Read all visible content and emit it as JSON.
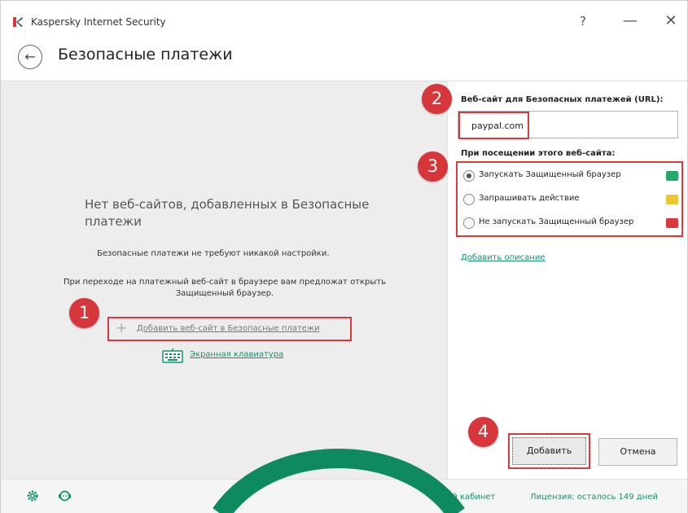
{
  "app": {
    "title": "Kaspersky Internet Security",
    "help": "?",
    "minimize": "—",
    "close": "✕"
  },
  "header": {
    "back": "←",
    "title": "Безопасные платежи"
  },
  "left_panel": {
    "empty_title": "Нет веб-сайтов, добавленных в Безопасные платежи",
    "empty_description": "Безопасные платежи не требуют никакой настройки.",
    "hint": "При переходе на платежный веб-сайт в браузере вам предложат открыть Защищенный браузер.",
    "add_site_plus": "+",
    "add_site_label": "Добавить веб-сайт в Безопасные платежи",
    "keyboard_label": "Экранная клавиатура"
  },
  "right_panel": {
    "url_label": "Веб-сайт для Безопасных платежей (URL):",
    "url_value": "paypal.com",
    "visit_label": "При посещении этого веб-сайта:",
    "options": [
      {
        "label": "Запускать Защищенный браузер",
        "checked": true,
        "color": "#24a86b"
      },
      {
        "label": "Запрашивать действие",
        "checked": false,
        "color": "#efc531"
      },
      {
        "label": "Не запускать Защищенный браузер",
        "checked": false,
        "color": "#d8393d"
      }
    ],
    "add_description": "Добавить описание",
    "add_button": "Добавить",
    "cancel_button": "Отмена"
  },
  "steps": [
    "1",
    "2",
    "3",
    "4"
  ],
  "footer": {
    "cabinet": "чный кабинет",
    "license": "Лицензия: осталось 149 дней"
  },
  "colors": {
    "accent_green": "#16906f",
    "marker_red": "#d7363a",
    "arc_green": "#0d8a5e"
  }
}
